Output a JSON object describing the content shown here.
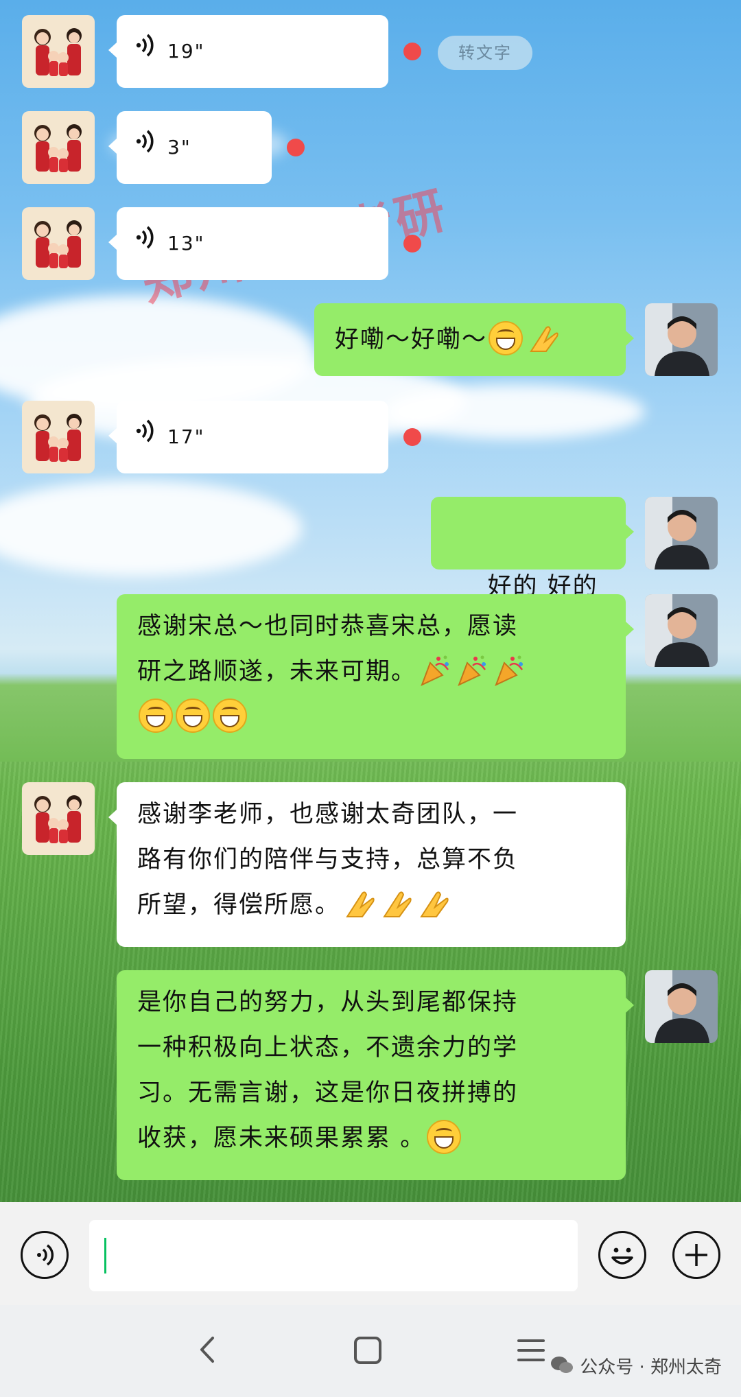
{
  "watermark": "郑州太奇考研",
  "messages": [
    {
      "side": "left",
      "type": "voice",
      "duration": "19\"",
      "unread": true,
      "convert_label": "转文字"
    },
    {
      "side": "left",
      "type": "voice",
      "duration": "3\"",
      "unread": true
    },
    {
      "side": "left",
      "type": "voice",
      "duration": "13\"",
      "unread": true
    },
    {
      "side": "right",
      "type": "text",
      "text": "好嘞～好嘞～"
    },
    {
      "side": "left",
      "type": "voice",
      "duration": "17\"",
      "unread": true
    },
    {
      "side": "right",
      "type": "text",
      "text": "好的 好的"
    },
    {
      "side": "right",
      "type": "text",
      "lines": [
        "感谢宋总～也同时恭喜宋总，愿读",
        "研之路顺遂，未来可期。"
      ]
    },
    {
      "side": "left",
      "type": "text",
      "lines": [
        "感谢李老师，也感谢太奇团队，一",
        "路有你们的陪伴与支持，总算不负",
        "所望，得偿所愿。"
      ]
    },
    {
      "side": "right",
      "type": "text",
      "lines": [
        "是你自己的努力，从头到尾都保持",
        "一种积极向上状态，不遗余力的学",
        "习。无需言谢，这是你日夜拼搏的",
        "收获，愿未来硕果累累 。"
      ]
    }
  ],
  "emoji_names": [
    "grinning-face",
    "pray-hands",
    "party-popper"
  ],
  "input": {
    "value": ""
  },
  "footer": {
    "brand": "公众号 · 郑州太奇"
  },
  "colors": {
    "my_bubble": "#95ec69",
    "their_bubble": "#ffffff",
    "unread_dot": "#f04a4a",
    "caret": "#07c160"
  }
}
